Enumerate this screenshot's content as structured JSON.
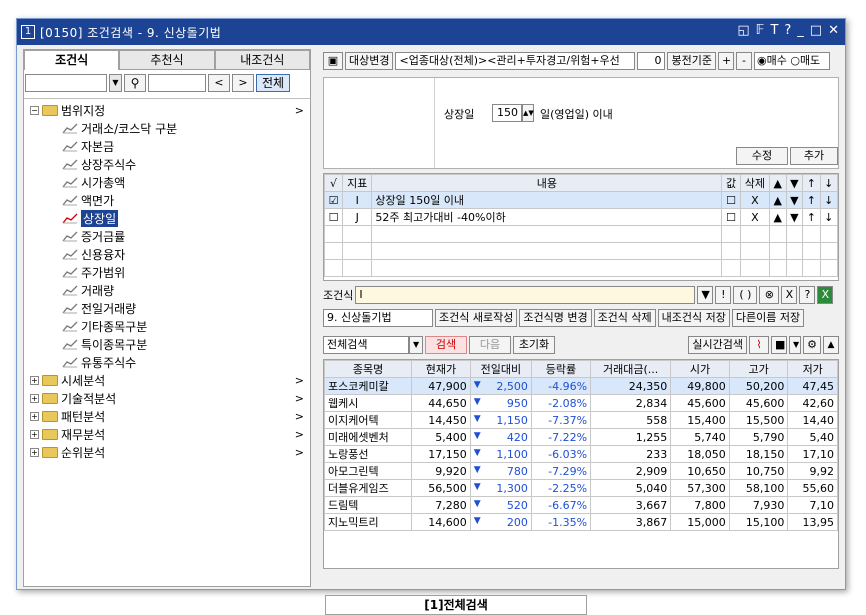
{
  "window": {
    "number": "1",
    "title": "[0150] 조건검색 - 9. 신상돌기법",
    "controls": [
      "◱",
      "𝔽",
      "T",
      "?",
      "_",
      "□",
      "✕"
    ]
  },
  "left": {
    "tabs": [
      "조건식",
      "추천식",
      "내조건식"
    ],
    "search_all": "전체",
    "prev": "<",
    "next": ">",
    "tree": [
      {
        "label": "범위지정",
        "type": "group",
        "expanded": true
      },
      {
        "label": "거래소/코스닥 구분",
        "type": "leaf"
      },
      {
        "label": "자본금",
        "type": "leaf"
      },
      {
        "label": "상장주식수",
        "type": "leaf"
      },
      {
        "label": "시가총액",
        "type": "leaf"
      },
      {
        "label": "액면가",
        "type": "leaf"
      },
      {
        "label": "상장일",
        "type": "leaf",
        "selected": true
      },
      {
        "label": "증거금률",
        "type": "leaf"
      },
      {
        "label": "신용융자",
        "type": "leaf"
      },
      {
        "label": "주가범위",
        "type": "leaf"
      },
      {
        "label": "거래량",
        "type": "leaf"
      },
      {
        "label": "전일거래량",
        "type": "leaf"
      },
      {
        "label": "기타종목구분",
        "type": "leaf"
      },
      {
        "label": "특이종목구분",
        "type": "leaf"
      },
      {
        "label": "유통주식수",
        "type": "leaf"
      },
      {
        "label": "시세분석",
        "type": "group"
      },
      {
        "label": "기술적분석",
        "type": "group"
      },
      {
        "label": "패턴분석",
        "type": "group"
      },
      {
        "label": "재무분석",
        "type": "group"
      },
      {
        "label": "순위분석",
        "type": "group"
      }
    ]
  },
  "top": {
    "target_btn": "대상변경",
    "target_text": "<업종대상(전체)><관리+투자경고/위험+우선",
    "period_val": "0",
    "period_label": "봉전기준",
    "plus": "+",
    "minus": "-",
    "buy": "매수",
    "sell": "매도"
  },
  "cond": {
    "label": "상장일",
    "value": "150",
    "unit": "일(영업일) 이내",
    "edit": "수정",
    "add": "추가"
  },
  "cond_grid": {
    "headers": [
      "√",
      "지표",
      "내용",
      "값",
      "삭제",
      "▲",
      "▼",
      "↑",
      "↓"
    ],
    "rows": [
      {
        "check": true,
        "id": "I",
        "text": "상장일 150일 이내",
        "del": "X"
      },
      {
        "check": false,
        "id": "J",
        "text": "52주 최고가대비 -40%이하",
        "del": "X"
      }
    ]
  },
  "formula": {
    "label": "조건식",
    "value": "I"
  },
  "actions": {
    "name": "9. 신상돌기법",
    "new": "조건식 새로작성",
    "rename": "조건식명 변경",
    "delete": "조건식 삭제",
    "save": "내조건식 저장",
    "saveas": "다른이름 저장"
  },
  "search": {
    "scope": "전체검색",
    "search": "검색",
    "next": "다음",
    "reset": "초기화",
    "realtime": "실시간검색"
  },
  "result": {
    "headers": [
      "종목명",
      "현재가",
      "전일대비",
      "등락률",
      "거래대금(...",
      "시가",
      "고가",
      "저가"
    ],
    "rows": [
      [
        "포스코케미칼",
        "47,900",
        "2,500",
        "-4.96%",
        "24,350",
        "49,800",
        "50,200",
        "47,45"
      ],
      [
        "웹케시",
        "44,650",
        "950",
        "-2.08%",
        "2,834",
        "45,600",
        "45,600",
        "42,60"
      ],
      [
        "이지케어텍",
        "14,450",
        "1,150",
        "-7.37%",
        "558",
        "15,400",
        "15,500",
        "14,40"
      ],
      [
        "미래에셋벤처",
        "5,400",
        "420",
        "-7.22%",
        "1,255",
        "5,740",
        "5,790",
        "5,40"
      ],
      [
        "노랑풍선",
        "17,150",
        "1,100",
        "-6.03%",
        "233",
        "18,050",
        "18,150",
        "17,10"
      ],
      [
        "아모그린텍",
        "9,920",
        "780",
        "-7.29%",
        "2,909",
        "10,650",
        "10,750",
        "9,92"
      ],
      [
        "더블유게임즈",
        "56,500",
        "1,300",
        "-2.25%",
        "5,040",
        "57,300",
        "58,100",
        "55,60"
      ],
      [
        "드림텍",
        "7,280",
        "520",
        "-6.67%",
        "3,667",
        "7,800",
        "7,930",
        "7,10"
      ],
      [
        "지노믹트리",
        "14,600",
        "200",
        "-1.35%",
        "3,867",
        "15,000",
        "15,100",
        "13,95"
      ]
    ]
  },
  "bottom_tab": "[1]전체검색"
}
